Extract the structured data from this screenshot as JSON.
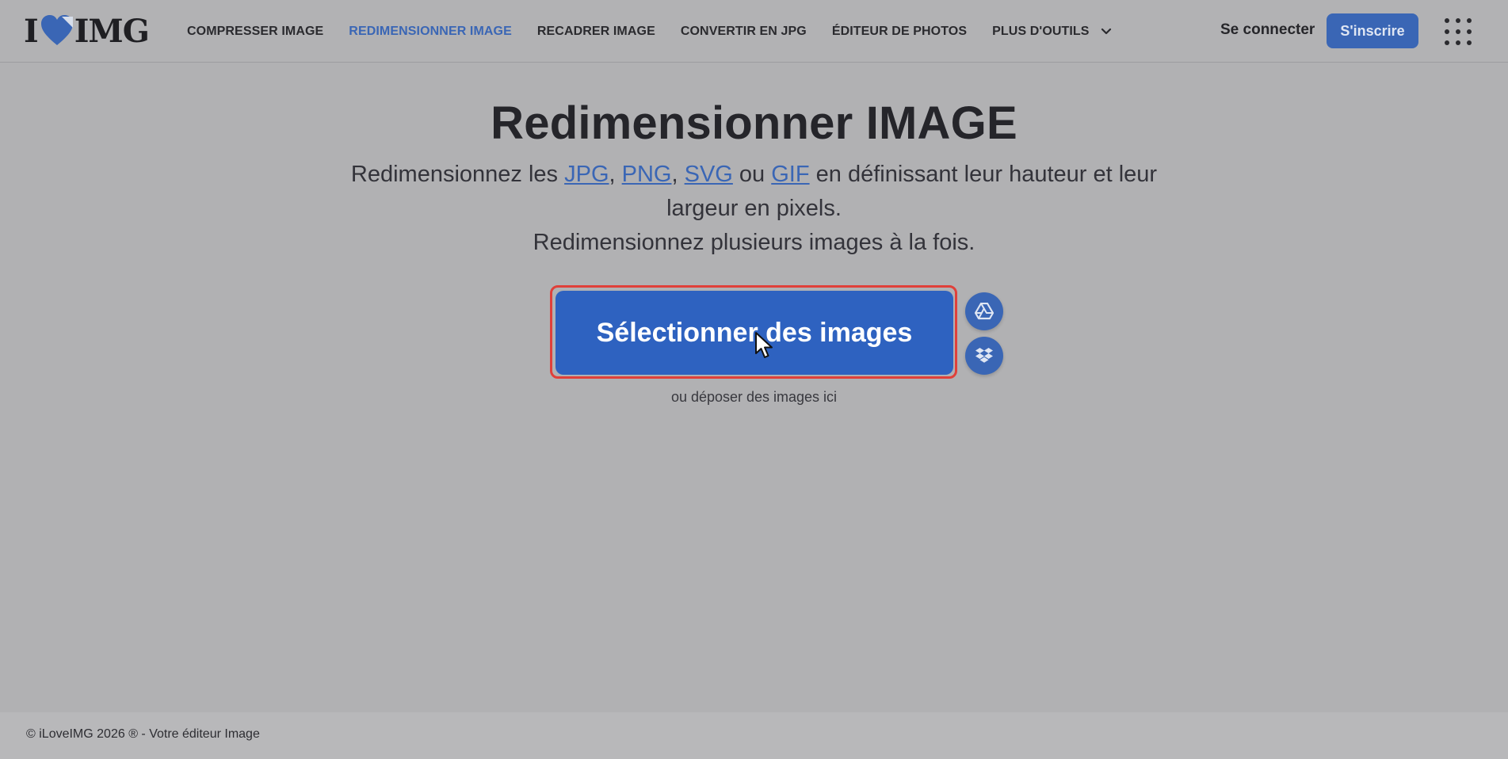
{
  "header": {
    "logo": {
      "left_text": "I",
      "right_text": "IMG",
      "icon": "heart-icon",
      "brand_color": "#3a66b5"
    },
    "nav": [
      {
        "label": "COMPRESSER IMAGE",
        "active": false
      },
      {
        "label": "REDIMENSIONNER IMAGE",
        "active": true
      },
      {
        "label": "RECADRER IMAGE",
        "active": false
      },
      {
        "label": "CONVERTIR EN JPG",
        "active": false
      },
      {
        "label": "ÉDITEUR DE PHOTOS",
        "active": false
      },
      {
        "label": "PLUS D'OUTILS",
        "active": false,
        "icon": "chevron-down-icon"
      }
    ],
    "login_label": "Se connecter",
    "signup_label": "S'inscrire",
    "apps_icon": "grid-icon"
  },
  "main": {
    "title": "Redimensionner IMAGE",
    "subtitle": {
      "prefix": "Redimensionnez les ",
      "formats": [
        "JPG",
        "PNG",
        "SVG",
        "GIF"
      ],
      "sep1": ", ",
      "sep2": ", ",
      "sep3": " ou ",
      "line1_suffix": " en définissant leur hauteur et leur",
      "line2": "largeur en pixels.",
      "line3": "Redimensionnez plusieurs images à la fois."
    },
    "select_button_label": "Sélectionner des images",
    "cloud_buttons": [
      {
        "icon": "google-drive-icon"
      },
      {
        "icon": "dropbox-icon"
      }
    ],
    "drop_hint": "ou déposer des images ici"
  },
  "footer": {
    "text": "© iLoveIMG 2026 ® - Votre éditeur Image"
  },
  "colors": {
    "overlay_background": "#b1b1b3",
    "accent": "#3a66b5",
    "highlight_border": "#e0403a"
  }
}
